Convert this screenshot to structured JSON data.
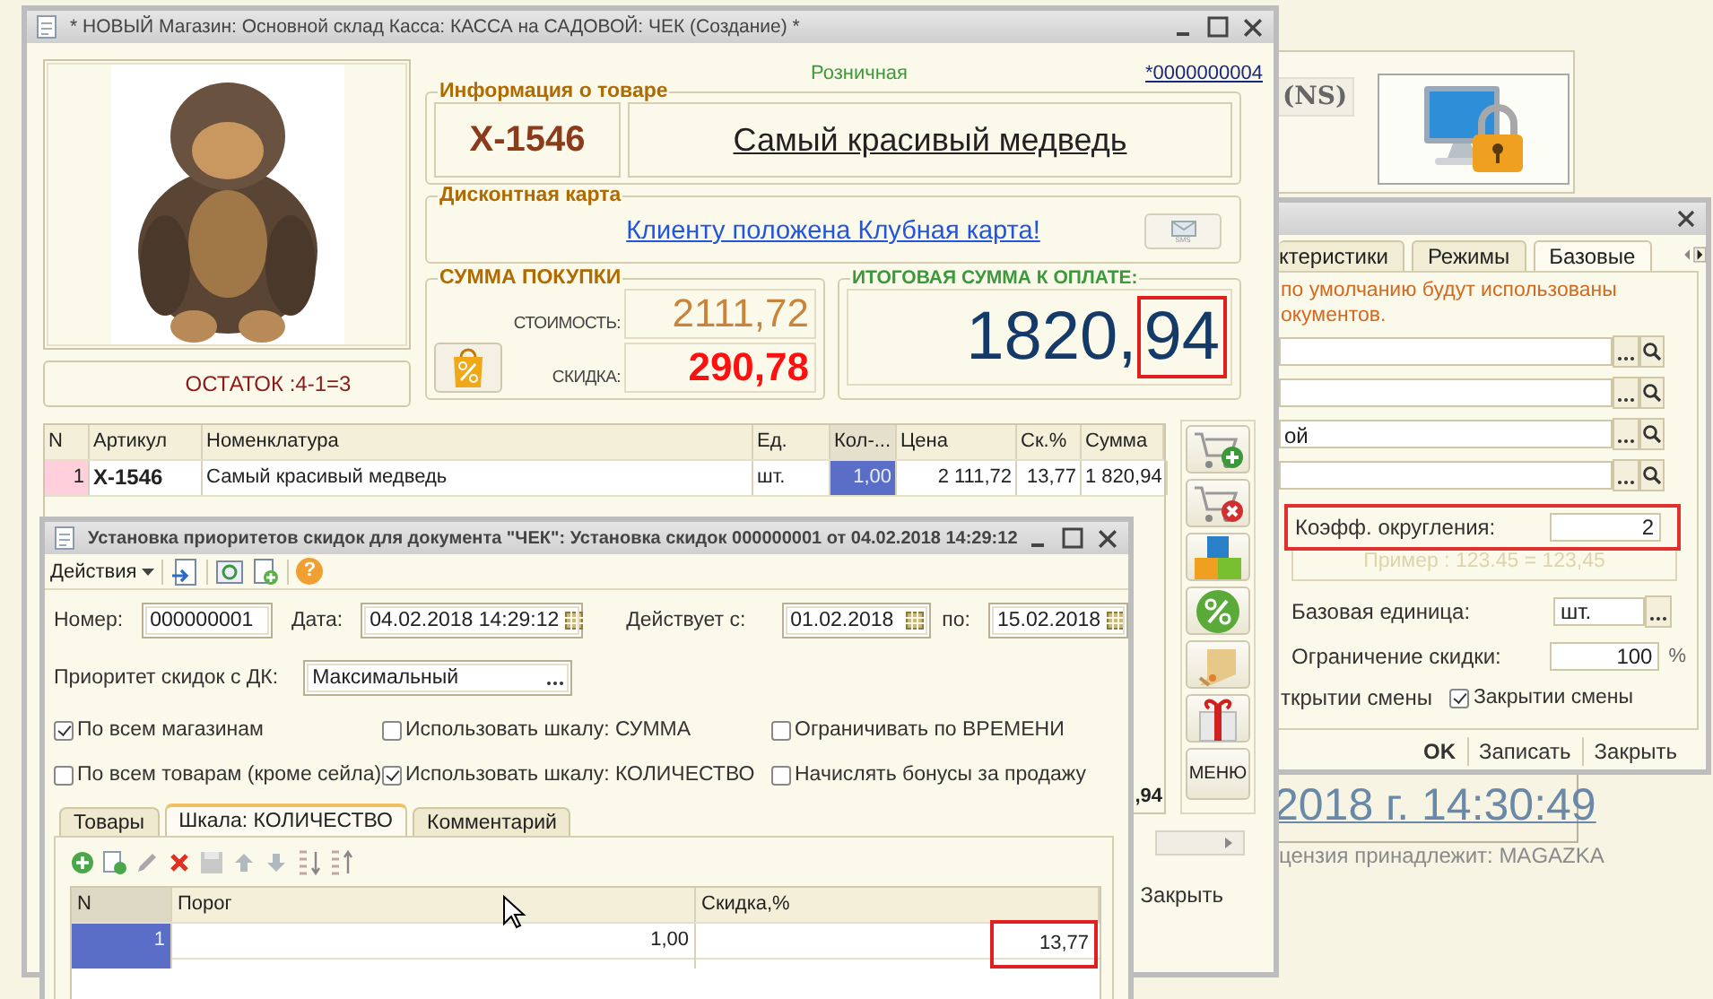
{
  "background": {
    "ns_label": "(NS)",
    "clock": "2018 г. 14:30:49",
    "license": "цензия принадлежит: MAGAZKA"
  },
  "settings_window": {
    "tabs": [
      {
        "label": "ктеристики",
        "selected": false
      },
      {
        "label": "Режимы",
        "selected": false
      },
      {
        "label": "Базовые",
        "selected": true
      }
    ],
    "note_lines": [
      "по умолчанию будут использованы",
      "окументов."
    ],
    "lookup_fields": [
      {
        "kind": "lookup"
      },
      {
        "kind": "lookup"
      },
      {
        "kind": "lookup",
        "value": "ой"
      },
      {
        "kind": "lookup"
      }
    ],
    "rounding": {
      "label": "Коэфф. округления:",
      "value": "2",
      "example": "Пример : 123.45 = 123,45"
    },
    "base_unit": {
      "label": "Базовая единица:",
      "value": "шт."
    },
    "discount_limit": {
      "label": "Ограничение скидки:",
      "value": "100",
      "unit": "%"
    },
    "shift_open_label": "ткрытии смены",
    "shift_close": {
      "label": "Закрытии смены",
      "checked": true
    },
    "buttons": [
      {
        "label": "OK",
        "default": true
      },
      {
        "label": "Записать",
        "default": false
      },
      {
        "label": "Закрыть",
        "default": false
      }
    ]
  },
  "main_window": {
    "title": "* НОВЫЙ Магазин: Основной склад Касса: КАССА на САДОВОЙ: ЧЕК (Создание) *",
    "price_type": "Розничная",
    "document_number": "*0000000004",
    "stock": "ОСТАТОК :4-1=3",
    "product_info": {
      "title": "Информация о товаре",
      "article": "X-1546",
      "name": "Самый красивый медведь"
    },
    "discount_card": {
      "title": "Дисконтная карта",
      "link": "Клиенту положена Клубная карта!",
      "sms_label": "SMS"
    },
    "purchase_sum": {
      "title": "СУММА ПОКУПКИ",
      "cost_label": "СТОИМОСТЬ:",
      "cost": "2111,72",
      "discount_label": "СКИДКА:",
      "discount": "290,78"
    },
    "total": {
      "title": "ИТОГОВАЯ СУММА К ОПЛАТЕ:",
      "integer_part": "1820,",
      "fraction": "94"
    },
    "table": {
      "columns": [
        {
          "label": "N",
          "current": false
        },
        {
          "label": "Артикул",
          "current": false
        },
        {
          "label": "Номенклатура",
          "current": false
        },
        {
          "label": "Ед.",
          "current": false
        },
        {
          "label": "Кол-...",
          "current": true
        },
        {
          "label": "Цена",
          "current": false
        },
        {
          "label": "Ск.%",
          "current": false
        },
        {
          "label": "Сумма",
          "current": false
        }
      ],
      "rows": [
        {
          "selected": true,
          "cells": [
            "1",
            "X-1546",
            "Самый красивый медведь",
            "шт.",
            "1,00",
            "2 111,72",
            "13,77",
            "1 820,94"
          ]
        }
      ],
      "footer_total": ",94"
    },
    "menu_button": "МЕНЮ",
    "close_button": "Закрыть"
  },
  "dialog": {
    "title": "Установка приоритетов скидок для документа \"ЧЕК\": Установка скидок 000000001 от 04.02.2018 14:29:12",
    "actions_menu": "Действия",
    "help_button": "?",
    "number_label": "Номер:",
    "number": "000000001",
    "date_label": "Дата:",
    "date": "04.02.2018 14:29:12",
    "valid_from_label": "Действует с:",
    "valid_from": "01.02.2018",
    "valid_to_label": "по:",
    "valid_to": "15.02.2018",
    "priority_label": "Приоритет скидок с ДК:",
    "priority": "Максимальный",
    "options": [
      {
        "label": "По всем магазинам",
        "checked": true
      },
      {
        "label": "Использовать шкалу: СУММА",
        "checked": false
      },
      {
        "label": "Ограничивать по ВРЕМЕНИ",
        "checked": false
      },
      {
        "label": "По всем товарам (кроме сейла)",
        "checked": false
      },
      {
        "label": "Использовать шкалу: КОЛИЧЕСТВО",
        "checked": true
      },
      {
        "label": "Начислять бонусы за продажу",
        "checked": false
      }
    ],
    "tabs": [
      {
        "label": "Товары",
        "selected": false
      },
      {
        "label": "Шкала: КОЛИЧЕСТВО",
        "selected": true
      },
      {
        "label": "Комментарий",
        "selected": false
      }
    ],
    "scale_table": {
      "columns": [
        "N",
        "Порог",
        "Скидка,%"
      ],
      "rows": [
        {
          "selected": true,
          "cells": [
            "1",
            "1,00",
            "13,77"
          ]
        }
      ]
    }
  }
}
